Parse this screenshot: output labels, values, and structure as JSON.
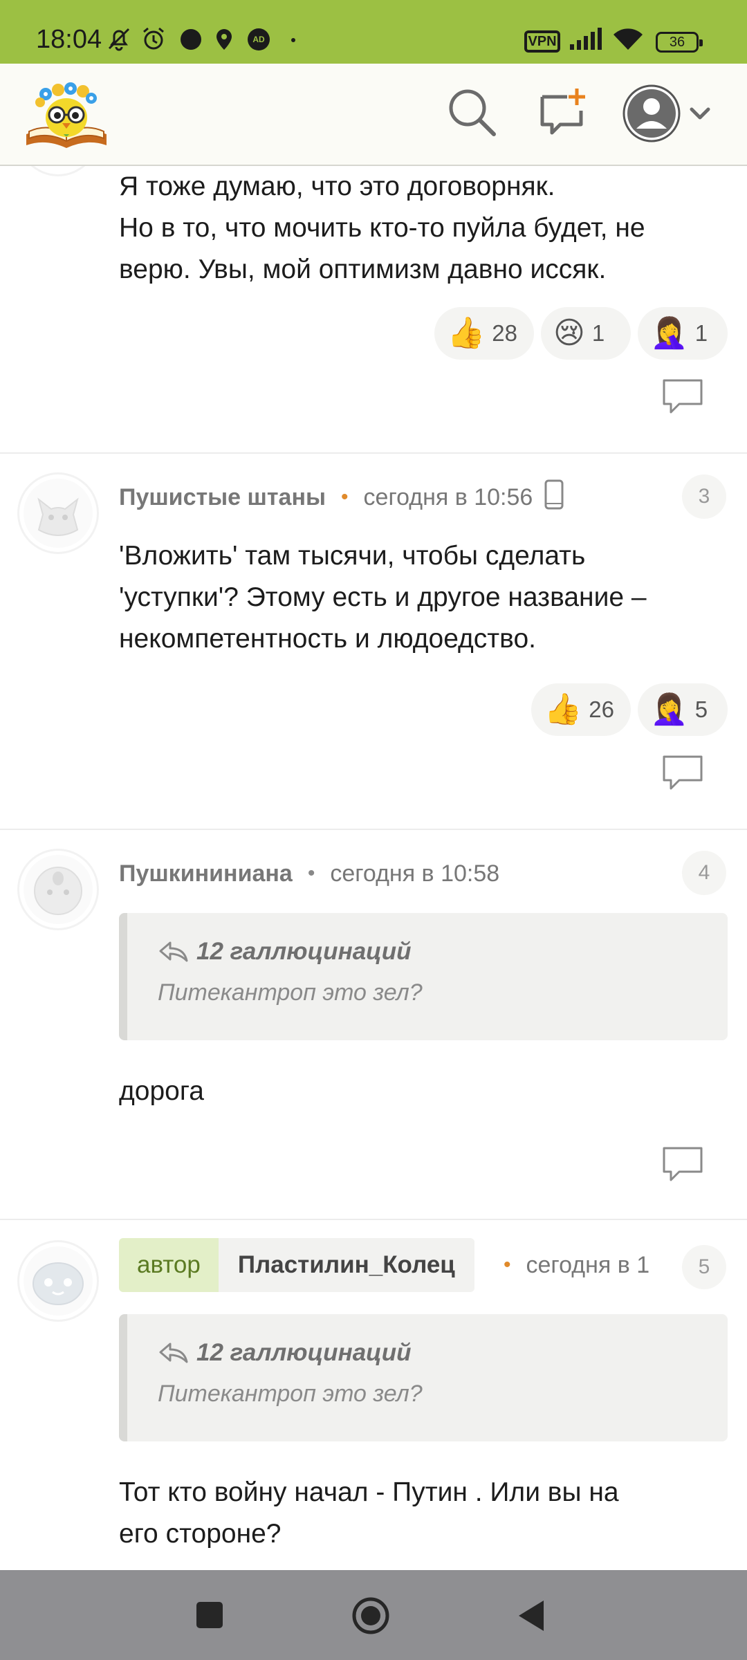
{
  "status": {
    "time": "18:04",
    "vpn": "VPN",
    "battery": "36"
  },
  "header": {
    "logo": "books-owl-logo",
    "search": "search-icon",
    "new_post": "new-post-icon",
    "profile": "profile-avatar-icon"
  },
  "comments": [
    {
      "text_lines": [
        "Я тоже думаю, что это договорняк.",
        "Но в то, что мочить кто-то пуйла будет, не",
        "верю. Увы, мой оптимизм давно иссяк."
      ],
      "reactions": [
        {
          "emoji": "👍",
          "count": "28"
        },
        {
          "emoji": "😢",
          "count": "1"
        },
        {
          "emoji": "🤦‍♀️",
          "count": "1"
        }
      ]
    },
    {
      "user": "Пушистые штаны",
      "date": "сегодня в 10:56",
      "number": "3",
      "text_lines": [
        "'Вложить' там тысячи, чтобы сделать",
        "'уступки'? Этому есть и другое название –",
        "некомпетентность и людоедство."
      ],
      "reactions": [
        {
          "emoji": "👍",
          "count": "26"
        },
        {
          "emoji": "🤦‍♀️",
          "count": "5"
        }
      ]
    },
    {
      "user": "Пушкининиана",
      "date": "сегодня в 10:58",
      "number": "4",
      "quote": {
        "author": "12 галлюцинаций",
        "text": "Питекантроп это зел?"
      },
      "text_lines": [
        "дорога"
      ]
    },
    {
      "author_tag": "автор",
      "user": "Пластилин_Колец",
      "date": "сегодня в 1",
      "number": "5",
      "quote": {
        "author": "12 галлюцинаций",
        "text": "Питекантроп это зел?"
      },
      "text_lines": [
        "Тот кто войну начал - Путин . Или вы на",
        "его стороне?"
      ]
    }
  ]
}
